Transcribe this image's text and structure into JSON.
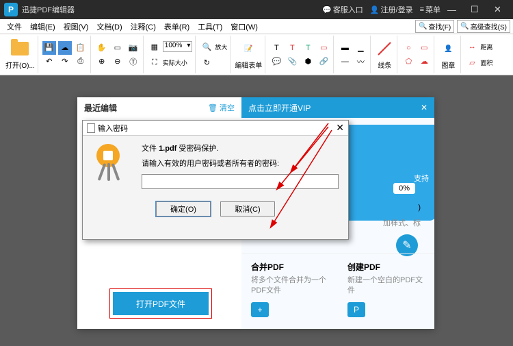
{
  "titlebar": {
    "app_name": "迅捷PDF编辑器",
    "customer_service": "客服入口",
    "login": "注册/登录",
    "menu": "菜单"
  },
  "menubar": {
    "items": [
      "文件",
      "编辑(E)",
      "视图(V)",
      "文档(D)",
      "注释(C)",
      "表单(R)",
      "工具(T)",
      "窗口(W)"
    ],
    "search": "查找(F)",
    "adv_search": "高级查找(S)"
  },
  "toolbar": {
    "open": "打开(O)...",
    "zoom_value": "100%",
    "zoom_actual": "实际大小",
    "fangda": "放大",
    "edit_form": "编辑表单",
    "line_label": "线条",
    "image_label": "图章",
    "dist": "距离",
    "area": "面积"
  },
  "startpanel": {
    "recent_title": "最近编辑",
    "clear": "清空",
    "vip_title": "点击立即开通VIP",
    "pct": "0%",
    "open_btn": "打开PDF文件",
    "feat_text": "加样式、标",
    "support": "支持",
    "card1": {
      "title": "合并PDF",
      "desc": "将多个文件合并为一个PDF文件",
      "icon": "+"
    },
    "card2": {
      "title": "创建PDF",
      "desc": "新建一个空白的PDF文件",
      "icon": "P"
    },
    "close_d": ")"
  },
  "pwdialog": {
    "title": "输入密码",
    "line1_pre": "文件 ",
    "filename": "1.pdf",
    "line1_post": " 受密码保护.",
    "line2": "请输入有效的用户密码或者所有者的密码:",
    "ok": "确定(O)",
    "cancel": "取消(C)"
  }
}
